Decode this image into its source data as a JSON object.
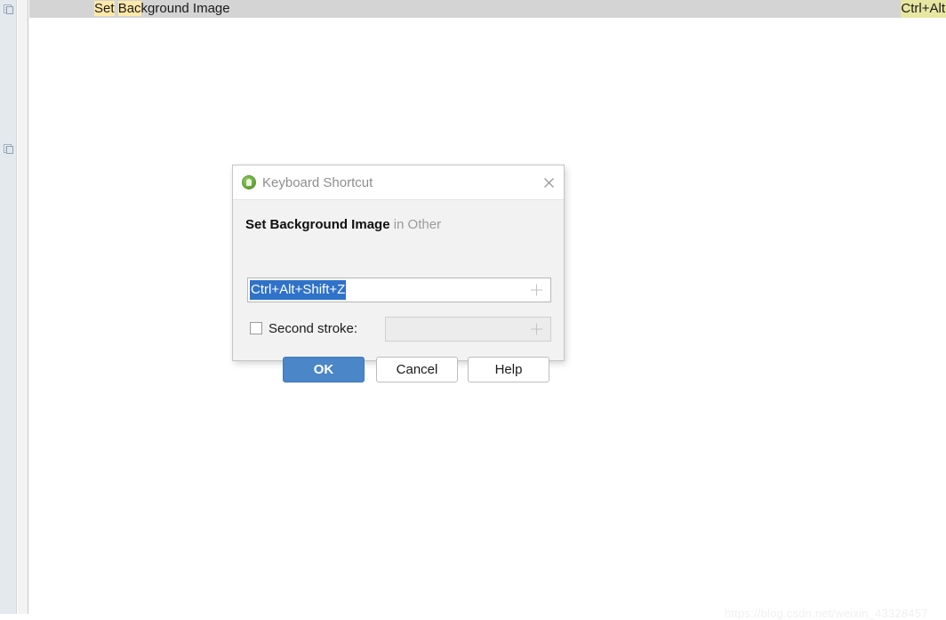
{
  "window": {
    "header": {
      "action_title_highlight_1": "Set",
      "action_title_mid": " ",
      "action_title_highlight_2": "Bac",
      "action_title_rest": "kground Image",
      "shortcut_label": "Ctrl+Alt"
    },
    "watermark": "https://blog.csdn.net/weixin_43328457",
    "sidebar": {
      "items": [
        {
          "name": "tool-window-top",
          "icon": "document-icon"
        },
        {
          "name": "tool-window-bottom",
          "icon": "document-icon"
        }
      ]
    }
  },
  "dialog": {
    "title": "Keyboard Shortcut",
    "app_icon": "android-studio-icon",
    "close_icon": "close-icon",
    "action_name": "Set Background Image",
    "action_scope": "in Other",
    "first_stroke": {
      "value": "Ctrl+Alt+Shift+Z",
      "selected": true,
      "add_icon": "plus-icon"
    },
    "second_stroke": {
      "checkbox_checked": false,
      "label": "Second stroke:",
      "value": "",
      "placeholder": "",
      "enabled": false,
      "add_icon": "plus-icon"
    },
    "buttons": {
      "ok": "OK",
      "cancel": "Cancel",
      "help": "Help"
    }
  },
  "colors": {
    "accent_blue": "#4a86c8",
    "selection_blue": "#2f72c8",
    "search_highlight_yellow": "#ffe9a8",
    "shortcut_highlight_yellow": "#e8e7a2",
    "header_grey": "#d4d4d4",
    "dialog_body_grey": "#f2f2f2"
  }
}
